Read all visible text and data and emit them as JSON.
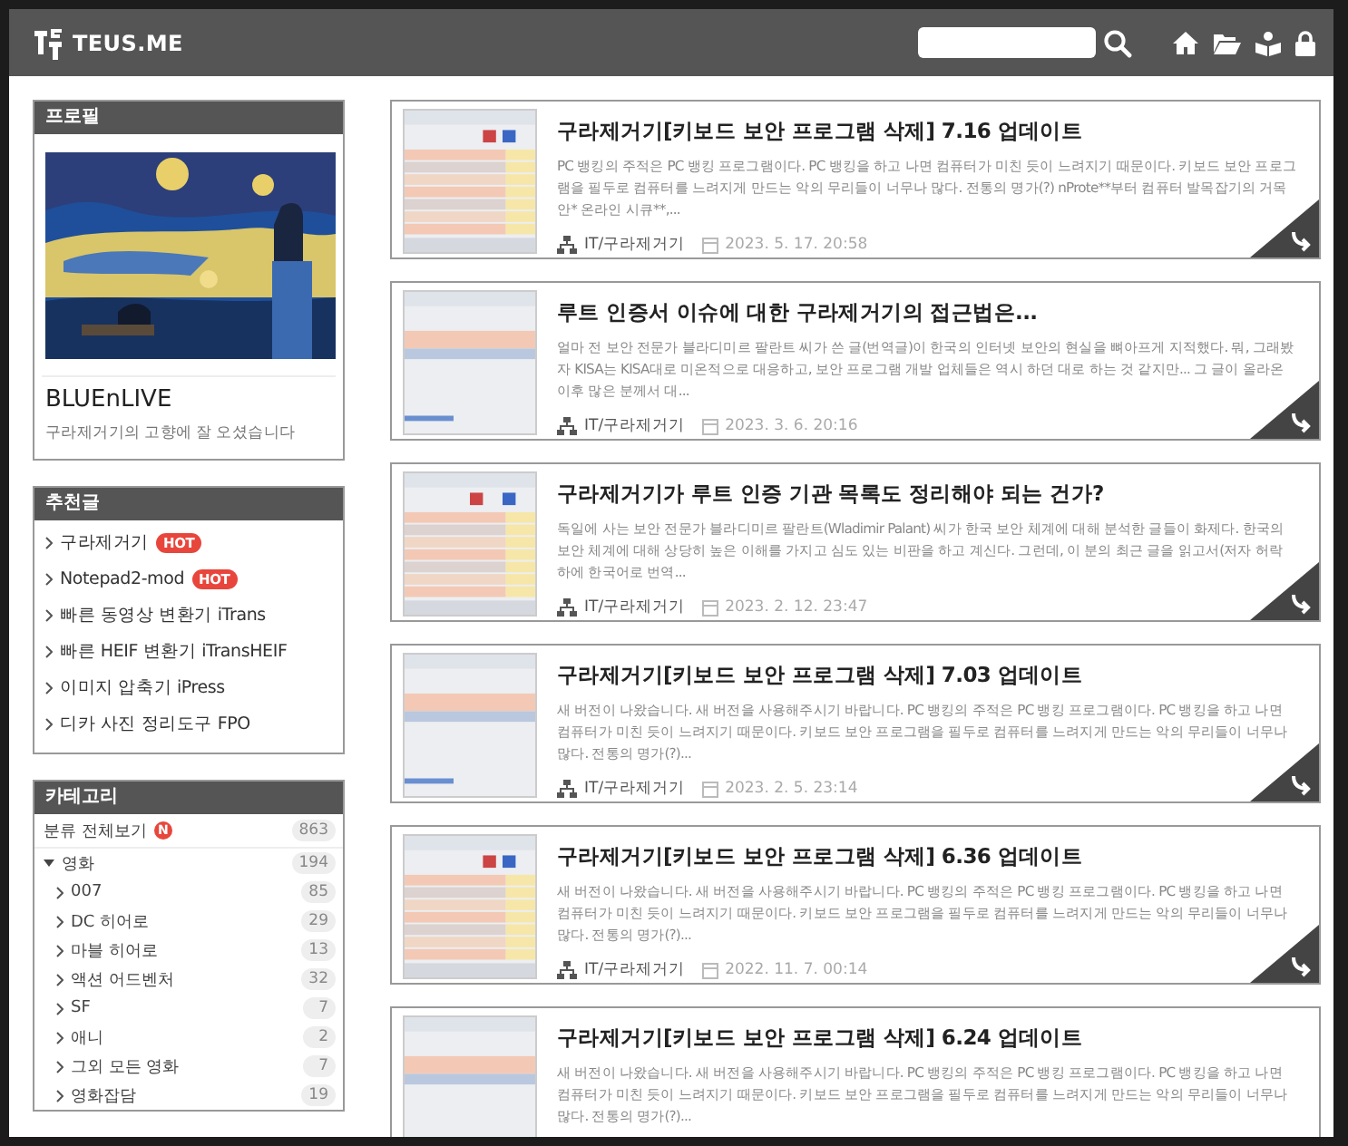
{
  "header": {
    "site_name": "TEUS.ME"
  },
  "profile": {
    "title": "프로필",
    "name": "BLUEnLIVE",
    "tagline": "구라제거기의 고향에 잘 오셨습니다"
  },
  "recommended": {
    "title": "추천글",
    "items": [
      {
        "label": "구라제거기",
        "badge": "HOT"
      },
      {
        "label": "Notepad2-mod",
        "badge": "HOT"
      },
      {
        "label": "빠른 동영상 변환기 iTrans"
      },
      {
        "label": "빠른 HEIF 변환기 iTransHEIF"
      },
      {
        "label": "이미지 압축기 iPress"
      },
      {
        "label": "디카 사진 정리도구 FPO"
      }
    ]
  },
  "categories": {
    "title": "카테고리",
    "all": {
      "label": "분류 전체보기",
      "badge": "N",
      "count": "863"
    },
    "items": [
      {
        "label": "영화",
        "count": "194",
        "expanded": true,
        "children": [
          {
            "label": "007",
            "count": "85"
          },
          {
            "label": "DC 히어로",
            "count": "29"
          },
          {
            "label": "마블 히어로",
            "count": "13"
          },
          {
            "label": "액션 어드벤처",
            "count": "32"
          },
          {
            "label": "SF",
            "count": "7"
          },
          {
            "label": "애니",
            "count": "2"
          },
          {
            "label": "그외 모든 영화",
            "count": "7"
          },
          {
            "label": "영화잡담",
            "count": "19"
          }
        ]
      }
    ]
  },
  "posts": [
    {
      "title": "구라제거기[키보드 보안 프로그램 삭제] 7.16 업데이트",
      "excerpt": "PC 뱅킹의 주적은 PC 뱅킹 프로그램이다. PC 뱅킹을 하고 나면 컴퓨터가 미친 듯이 느려지기 때문이다. 키보드 보안 프로그램을 필두로 컴퓨터를 느려지게 만드는 악의 무리들이 너무나 많다. 전통의 명가(?) nProte**부터 컴퓨터 발목잡기의 거목 안* 온라인 시큐**,...",
      "category": "IT/구라제거기",
      "date": "2023. 5. 17. 20:58"
    },
    {
      "title": "루트 인증서 이슈에 대한 구라제거기의 접근법은...",
      "excerpt": "얼마 전 보안 전문가 블라디미르 팔란트 씨가 쓴 글(번역글)이 한국의 인터넷 보안의 현실을 뼈아프게 지적했다. 뭐, 그래봤자 KISA는 KISA대로 미온적으로 대응하고, 보안 프로그램 개발 업체들은 역시 하던 대로 하는 것 같지만... 그 글이 올라온 이후 많은 분께서 대...",
      "category": "IT/구라제거기",
      "date": "2023. 3. 6. 20:16"
    },
    {
      "title": "구라제거기가 루트 인증 기관 목록도 정리해야 되는 건가?",
      "excerpt": "독일에 사는 보안 전문가 블라디미르 팔란트(Wladimir Palant) 씨가 한국 보안 체계에 대해 분석한 글들이 화제다. 한국의 보안 체계에 대해 상당히 높은 이해를 가지고 심도 있는 비판을 하고 계신다. 그런데, 이 분의 최근 글을 읽고서(저자 허락 하에 한국어로 번역...",
      "category": "IT/구라제거기",
      "date": "2023. 2. 12. 23:47"
    },
    {
      "title": "구라제거기[키보드 보안 프로그램 삭제] 7.03 업데이트",
      "excerpt": "새 버전이 나왔습니다. 새 버전을 사용해주시기 바랍니다. PC 뱅킹의 주적은 PC 뱅킹 프로그램이다. PC 뱅킹을 하고 나면 컴퓨터가 미친 듯이 느려지기 때문이다. 키보드 보안 프로그램을 필두로 컴퓨터를 느려지게 만드는 악의 무리들이 너무나 많다. 전통의 명가(?)...",
      "category": "IT/구라제거기",
      "date": "2023. 2. 5. 23:14"
    },
    {
      "title": "구라제거기[키보드 보안 프로그램 삭제] 6.36 업데이트",
      "excerpt": "새 버전이 나왔습니다. 새 버전을 사용해주시기 바랍니다. PC 뱅킹의 주적은 PC 뱅킹 프로그램이다. PC 뱅킹을 하고 나면 컴퓨터가 미친 듯이 느려지기 때문이다. 키보드 보안 프로그램을 필두로 컴퓨터를 느려지게 만드는 악의 무리들이 너무나 많다. 전통의 명가(?)...",
      "category": "IT/구라제거기",
      "date": "2022. 11. 7. 00:14"
    },
    {
      "title": "구라제거기[키보드 보안 프로그램 삭제] 6.24 업데이트",
      "excerpt": "새 버전이 나왔습니다. 새 버전을 사용해주시기 바랍니다. PC 뱅킹의 주적은 PC 뱅킹 프로그램이다. PC 뱅킹을 하고 나면 컴퓨터가 미친 듯이 느려지기 때문이다. 키보드 보안 프로그램을 필두로 컴퓨터를 느려지게 만드는 악의 무리들이 너무나 많다. 전통의 명가(?)..."
    }
  ]
}
